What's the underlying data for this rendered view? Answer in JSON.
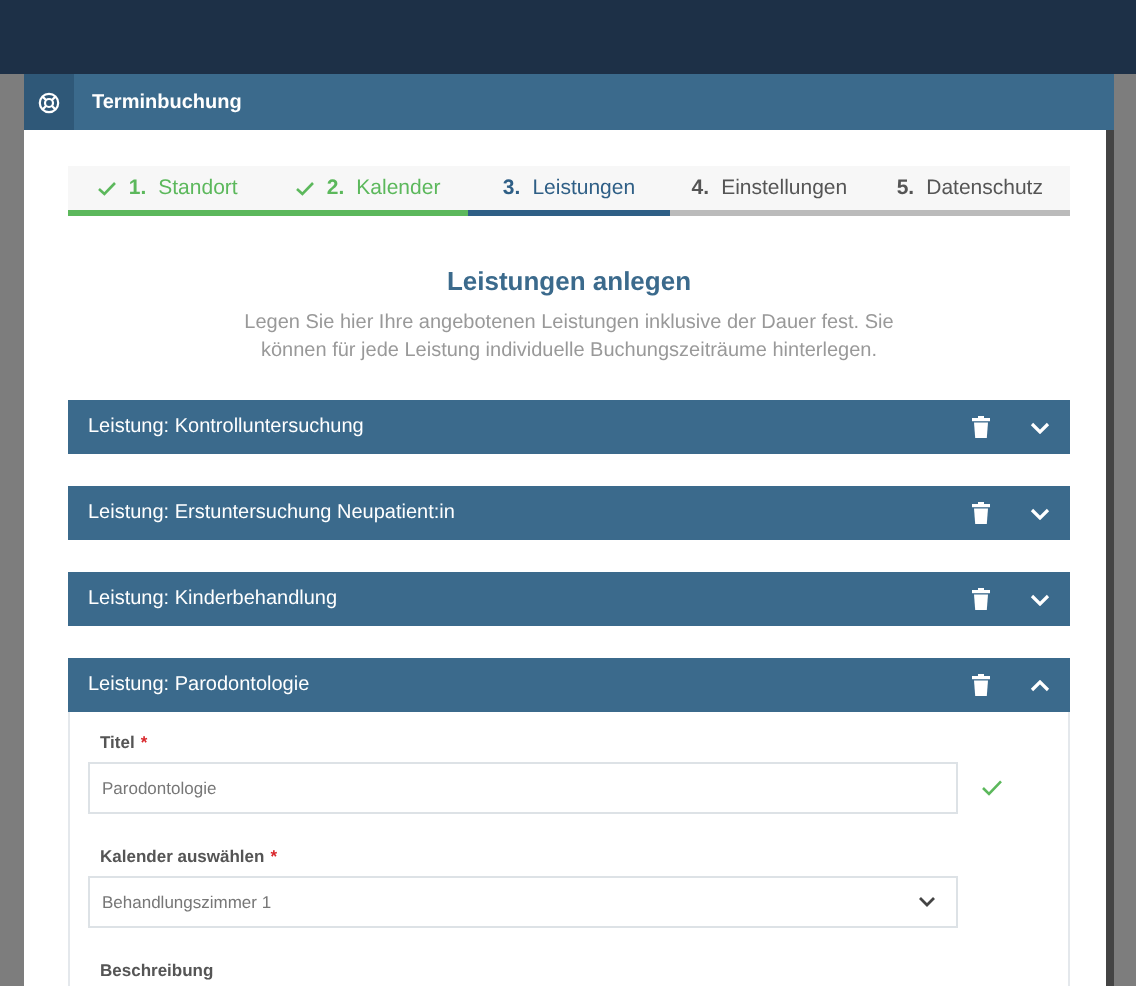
{
  "window": {
    "title": "Terminbuchung"
  },
  "steps": [
    {
      "number": "1.",
      "label": "Standort",
      "completed": true,
      "selected": false
    },
    {
      "number": "2.",
      "label": "Kalender",
      "completed": true,
      "selected": false
    },
    {
      "number": "3.",
      "label": "Leistungen",
      "completed": false,
      "selected": true
    },
    {
      "number": "4.",
      "label": "Einstellungen",
      "completed": false,
      "selected": false
    },
    {
      "number": "5.",
      "label": "Datenschutz",
      "completed": false,
      "selected": false
    }
  ],
  "heading": "Leistungen anlegen",
  "description": "Legen Sie hier Ihre angebotenen Leistungen inklusive der Dauer fest. Sie können für jede Leistung individuelle Buchungszeiträume hinterlegen.",
  "services": [
    {
      "title": "Leistung: Kontrolluntersuchung",
      "expanded": false
    },
    {
      "title": "Leistung: Erstuntersuchung Neupatient:in",
      "expanded": false
    },
    {
      "title": "Leistung: Kinderbehandlung",
      "expanded": false
    },
    {
      "title": "Leistung: Parodontologie",
      "expanded": true,
      "fields": [
        {
          "kind": "text",
          "label": "Titel",
          "required_mark": "*",
          "value": "Parodontologie",
          "valid": true
        },
        {
          "kind": "select",
          "label": "Kalender auswählen",
          "required_mark": "*",
          "value": "Behandlungszimmer 1",
          "valid": false
        },
        {
          "kind": "textarea",
          "label": "Beschreibung"
        }
      ]
    }
  ]
}
